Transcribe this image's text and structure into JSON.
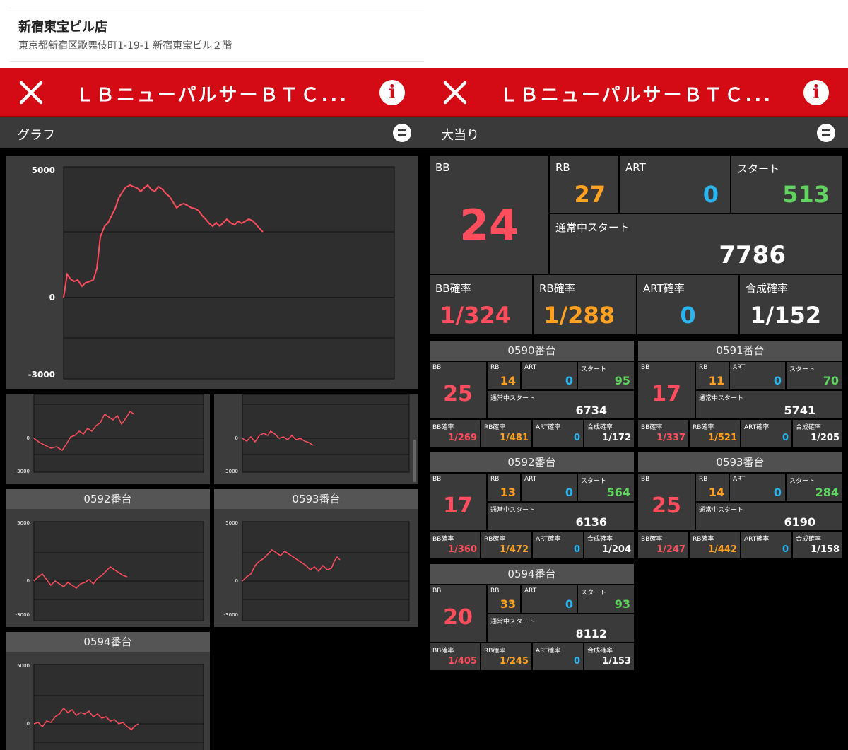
{
  "store": {
    "name": "新宿東宝ビル店",
    "address": "東京都新宿区歌舞伎町1-19-1 新宿東宝ビル２階"
  },
  "machine_title": "ＬＢニューパルサーＢＴＣ...",
  "left": {
    "section": "グラフ",
    "main_chart": {
      "ymax_label": "5000",
      "zero_label": "0",
      "ymin_label": "-3000"
    },
    "small_labels": {
      "ymax": "5000",
      "zero": "0",
      "ymin": "-3000"
    },
    "cards": [
      {
        "label": "0592番台"
      },
      {
        "label": "0593番台"
      },
      {
        "label": "0594番台"
      }
    ]
  },
  "right": {
    "section": "大当り",
    "summary": {
      "bb_label": "BB",
      "bb": "24",
      "rb_label": "RB",
      "rb": "27",
      "art_label": "ART",
      "art": "0",
      "start_label": "スタート",
      "start": "513",
      "normal_start_label": "通常中スタート",
      "normal_start": "7786",
      "bb_rate_label": "BB確率",
      "bb_rate": "1/324",
      "rb_rate_label": "RB確率",
      "rb_rate": "1/288",
      "art_rate_label": "ART確率",
      "art_rate": "0",
      "combined_rate_label": "合成確率",
      "combined_rate": "1/152"
    },
    "machines": [
      {
        "label": "0590番台",
        "bb": "25",
        "rb": "14",
        "art": "0",
        "start": "95",
        "normal_start": "6734",
        "bb_rate": "1/269",
        "rb_rate": "1/481",
        "art_rate": "0",
        "combined_rate": "1/172"
      },
      {
        "label": "0591番台",
        "bb": "17",
        "rb": "11",
        "art": "0",
        "start": "70",
        "normal_start": "5741",
        "bb_rate": "1/337",
        "rb_rate": "1/521",
        "art_rate": "0",
        "combined_rate": "1/205"
      },
      {
        "label": "0592番台",
        "bb": "17",
        "rb": "13",
        "art": "0",
        "start": "564",
        "normal_start": "6136",
        "bb_rate": "1/360",
        "rb_rate": "1/472",
        "art_rate": "0",
        "combined_rate": "1/204"
      },
      {
        "label": "0593番台",
        "bb": "25",
        "rb": "14",
        "art": "0",
        "start": "284",
        "normal_start": "6190",
        "bb_rate": "1/247",
        "rb_rate": "1/442",
        "art_rate": "0",
        "combined_rate": "1/158"
      },
      {
        "label": "0594番台",
        "bb": "20",
        "rb": "33",
        "art": "0",
        "start": "93",
        "normal_start": "8112",
        "bb_rate": "1/405",
        "rb_rate": "1/245",
        "art_rate": "0",
        "combined_rate": "1/153"
      }
    ],
    "mini_labels": {
      "bb": "BB",
      "rb": "RB",
      "art": "ART",
      "start": "スタート",
      "normal_start": "通常中スタート",
      "bb_rate": "BB確率",
      "rb_rate": "RB確率",
      "art_rate": "ART確率",
      "combined_rate": "合成確率"
    }
  },
  "colors": {
    "header_red": "#d40a14",
    "bb": "#ff4d5e",
    "rb": "#ffa020",
    "art": "#29b6f0",
    "start": "#5fd45f",
    "line": "#ff4d5e"
  },
  "icons": {
    "close": "close-icon",
    "info": "info-icon",
    "toggle": "collapse-icon"
  }
}
